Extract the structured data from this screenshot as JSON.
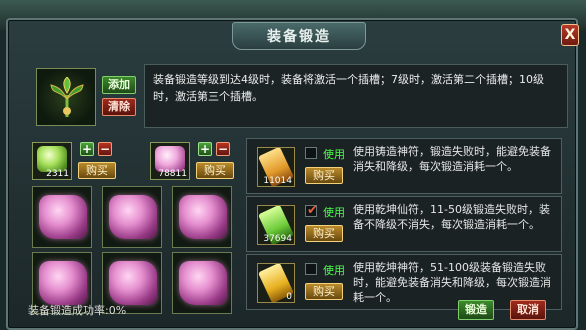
{
  "window": {
    "title": "装备锻造",
    "close_label": "X"
  },
  "top": {
    "add_label": "添加",
    "clear_label": "清除",
    "description": "装备锻造等级到达4级时，装备将激活一个插槽；7级时，激活第二个插槽；10级时，激活第三个插槽。"
  },
  "materials": [
    {
      "count": "2311",
      "plus": "+",
      "minus": "−",
      "buy_label": "购买",
      "color": "#a6e05a"
    },
    {
      "count": "78811",
      "plus": "+",
      "minus": "−",
      "buy_label": "购买",
      "color": "#f0a8dc"
    }
  ],
  "grid": {
    "slots": 6
  },
  "options": [
    {
      "count": "11014",
      "checked": false,
      "use_label": "使用",
      "buy_label": "购买",
      "description": "使用铸造神符，锻造失败时，能避免装备消失和降级，每次锻造消耗一个。",
      "color": "#e29a2a"
    },
    {
      "count": "37694",
      "checked": true,
      "use_label": "使用",
      "buy_label": "购买",
      "description": "使用乾坤仙符，11-50级锻造失败时，装备不降级不消失，每次锻造消耗一个。",
      "color": "#6ecc3a"
    },
    {
      "count": "0",
      "checked": false,
      "use_label": "使用",
      "buy_label": "购买",
      "description": "使用乾坤神符，51-100级装备锻造失败时，能避免装备消失和降级，每次锻造消耗一个。",
      "color": "#e8b020"
    }
  ],
  "footer": {
    "success_rate": "装备锻造成功率:0%",
    "forge_label": "锻造",
    "cancel_label": "取消"
  }
}
